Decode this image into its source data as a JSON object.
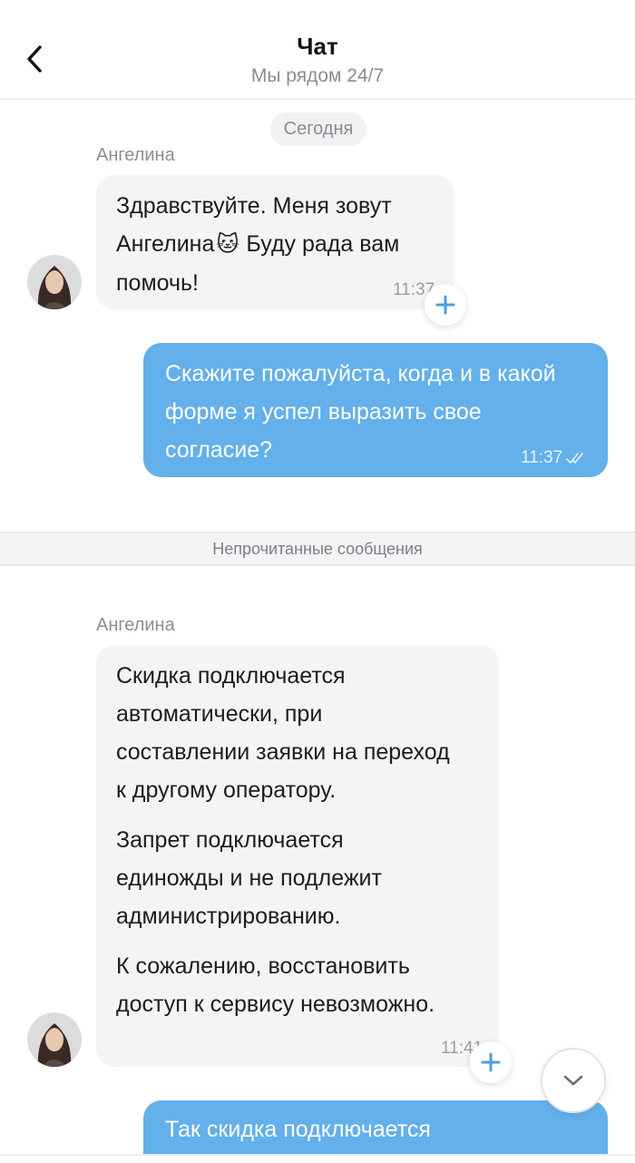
{
  "header": {
    "title": "Чат",
    "subtitle": "Мы рядом 24/7",
    "back_icon": "chevron-left-icon"
  },
  "date_separator": "Сегодня",
  "unread_divider": "Непрочитанные сообщения",
  "messages": [
    {
      "direction": "incoming",
      "sender": "Ангелина",
      "lines": [
        "Здравствуйте. Меня зовут",
        "Ангелина",
        "Буду рада вам",
        "помочь!"
      ],
      "emoji": "🐱",
      "time": "11:37"
    },
    {
      "direction": "outgoing",
      "lines": [
        "Скажите пожалуйста, когда и в какой",
        "форме я успел выразить свое",
        "согласие?"
      ],
      "time": "11:37",
      "status_icon": "double-check-icon"
    },
    {
      "direction": "incoming",
      "sender": "Ангелина",
      "paragraphs": [
        [
          "Скидка подключается",
          "автоматически, при",
          "составлении заявки на переход",
          "к другому оператору."
        ],
        [
          "Запрет подключается",
          "единожды и не подлежит",
          "администрированию."
        ],
        [
          "К сожалению, восстановить",
          "доступ к сервису невозможно."
        ]
      ],
      "time": "11:41"
    },
    {
      "direction": "outgoing",
      "lines": [
        "Так скидка подключается"
      ]
    }
  ],
  "colors": {
    "outgoing_bubble": "#63b0ea",
    "incoming_bubble": "#f3f4f6",
    "accent": "#4a9fe0"
  }
}
